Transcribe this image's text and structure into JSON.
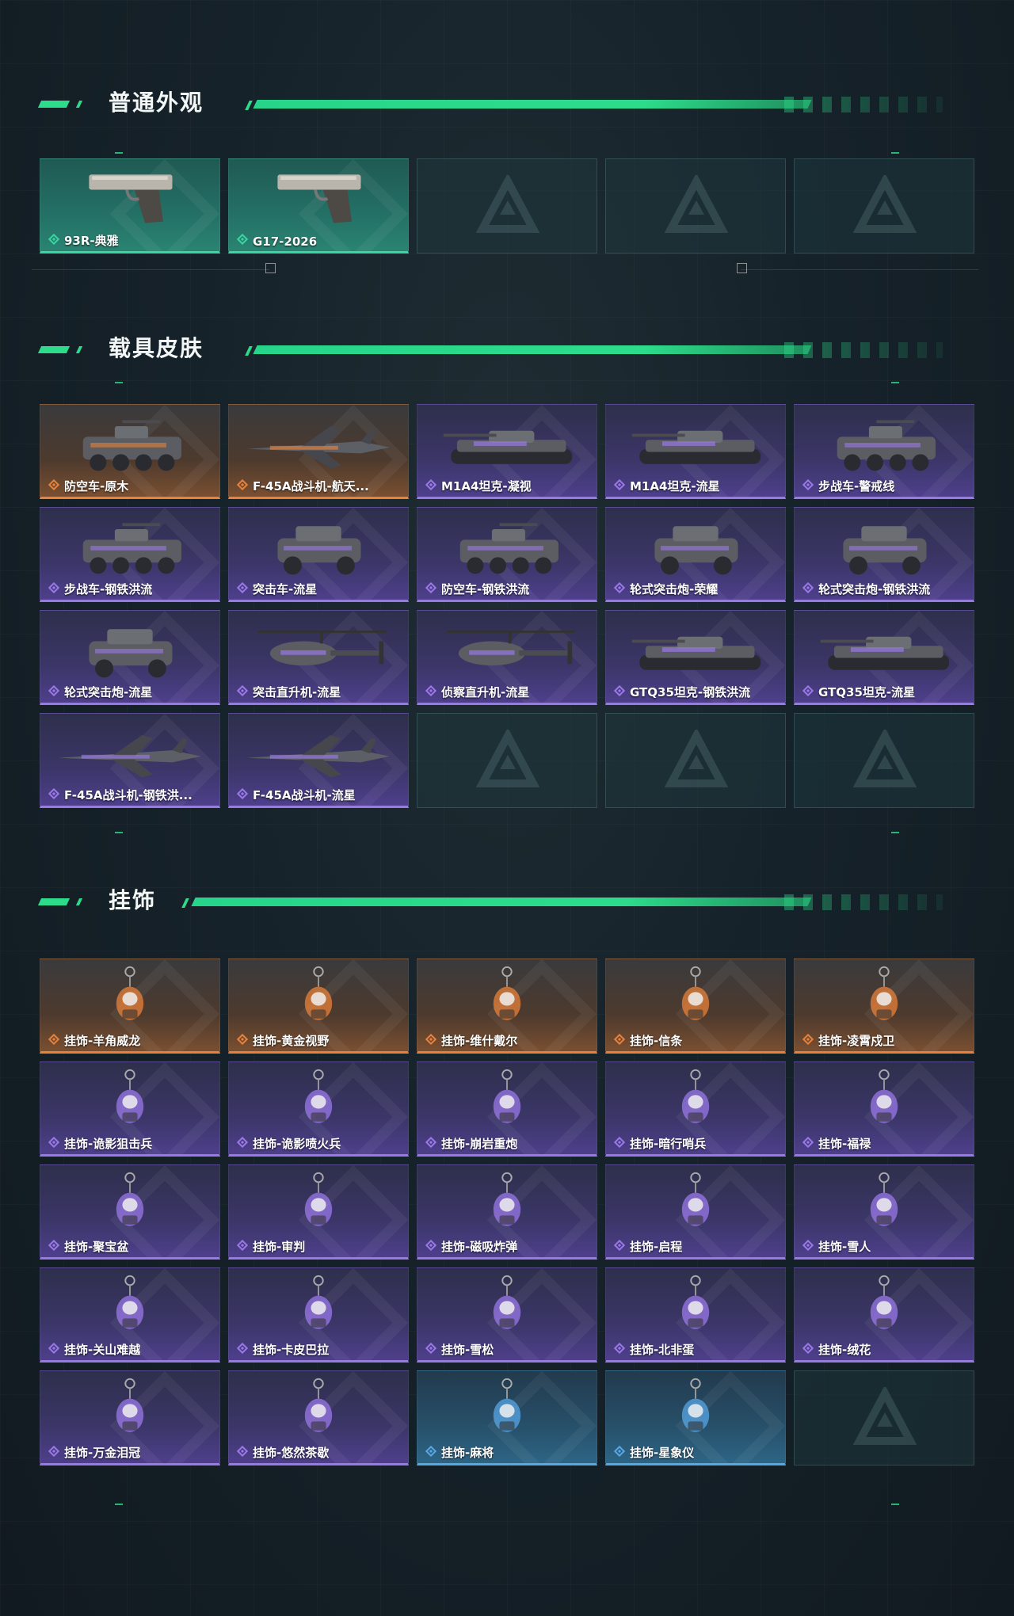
{
  "sections": [
    {
      "title": "普通外观",
      "items": [
        {
          "label": "93R-典雅",
          "rarity": "green",
          "icon": "pistol-icon"
        },
        {
          "label": "G17-2026",
          "rarity": "green",
          "icon": "pistol-icon"
        },
        {
          "label": "",
          "rarity": "empty",
          "icon": "logo-placeholder-icon"
        },
        {
          "label": "",
          "rarity": "empty",
          "icon": "logo-placeholder-icon"
        },
        {
          "label": "",
          "rarity": "empty",
          "icon": "logo-placeholder-icon"
        }
      ]
    },
    {
      "title": "载具皮肤",
      "items": [
        {
          "label": "防空车-原木",
          "rarity": "orange",
          "icon": "armored-vehicle-icon"
        },
        {
          "label": "F-45A战斗机-航天...",
          "rarity": "orange",
          "icon": "jet-icon"
        },
        {
          "label": "M1A4坦克-凝视",
          "rarity": "purple",
          "icon": "tank-icon"
        },
        {
          "label": "M1A4坦克-流星",
          "rarity": "purple",
          "icon": "tank-icon"
        },
        {
          "label": "步战车-警戒线",
          "rarity": "purple",
          "icon": "armored-vehicle-icon"
        },
        {
          "label": "步战车-钢铁洪流",
          "rarity": "purple",
          "icon": "armored-vehicle-icon"
        },
        {
          "label": "突击车-流星",
          "rarity": "purple",
          "icon": "assault-vehicle-icon"
        },
        {
          "label": "防空车-钢铁洪流",
          "rarity": "purple",
          "icon": "armored-vehicle-icon"
        },
        {
          "label": "轮式突击炮-荣耀",
          "rarity": "purple",
          "icon": "assault-vehicle-icon"
        },
        {
          "label": "轮式突击炮-钢铁洪流",
          "rarity": "purple",
          "icon": "assault-vehicle-icon"
        },
        {
          "label": "轮式突击炮-流星",
          "rarity": "purple",
          "icon": "assault-vehicle-icon"
        },
        {
          "label": "突击直升机-流星",
          "rarity": "purple",
          "icon": "helicopter-icon"
        },
        {
          "label": "侦察直升机-流星",
          "rarity": "purple",
          "icon": "helicopter-icon"
        },
        {
          "label": "GTQ35坦克-钢铁洪流",
          "rarity": "purple",
          "icon": "tank-icon"
        },
        {
          "label": "GTQ35坦克-流星",
          "rarity": "purple",
          "icon": "tank-icon"
        },
        {
          "label": "F-45A战斗机-钢铁洪...",
          "rarity": "purple",
          "icon": "jet-icon"
        },
        {
          "label": "F-45A战斗机-流星",
          "rarity": "purple",
          "icon": "jet-icon"
        },
        {
          "label": "",
          "rarity": "empty",
          "icon": "logo-placeholder-icon"
        },
        {
          "label": "",
          "rarity": "empty",
          "icon": "logo-placeholder-icon"
        },
        {
          "label": "",
          "rarity": "empty",
          "icon": "logo-placeholder-icon"
        }
      ]
    },
    {
      "title": "挂饰",
      "items": [
        {
          "label": "挂饰-羊角威龙",
          "rarity": "orange",
          "icon": "charm-icon"
        },
        {
          "label": "挂饰-黄金视野",
          "rarity": "orange",
          "icon": "charm-icon"
        },
        {
          "label": "挂饰-维什戴尔",
          "rarity": "orange",
          "icon": "charm-icon"
        },
        {
          "label": "挂饰-信条",
          "rarity": "orange",
          "icon": "charm-icon"
        },
        {
          "label": "挂饰-凌霄戍卫",
          "rarity": "orange",
          "icon": "charm-icon"
        },
        {
          "label": "挂饰-诡影狙击兵",
          "rarity": "purple",
          "icon": "charm-icon"
        },
        {
          "label": "挂饰-诡影喷火兵",
          "rarity": "purple",
          "icon": "charm-icon"
        },
        {
          "label": "挂饰-崩岩重炮",
          "rarity": "purple",
          "icon": "charm-icon"
        },
        {
          "label": "挂饰-暗行哨兵",
          "rarity": "purple",
          "icon": "charm-icon"
        },
        {
          "label": "挂饰-福禄",
          "rarity": "purple",
          "icon": "charm-icon"
        },
        {
          "label": "挂饰-聚宝盆",
          "rarity": "purple",
          "icon": "charm-icon"
        },
        {
          "label": "挂饰-审判",
          "rarity": "purple",
          "icon": "charm-icon"
        },
        {
          "label": "挂饰-磁吸炸弹",
          "rarity": "purple",
          "icon": "charm-icon"
        },
        {
          "label": "挂饰-启程",
          "rarity": "purple",
          "icon": "charm-icon"
        },
        {
          "label": "挂饰-雪人",
          "rarity": "purple",
          "icon": "charm-icon"
        },
        {
          "label": "挂饰-关山难越",
          "rarity": "purple",
          "icon": "charm-icon"
        },
        {
          "label": "挂饰-卡皮巴拉",
          "rarity": "purple",
          "icon": "charm-icon"
        },
        {
          "label": "挂饰-雪松",
          "rarity": "purple",
          "icon": "charm-icon"
        },
        {
          "label": "挂饰-北非蛋",
          "rarity": "purple",
          "icon": "charm-icon"
        },
        {
          "label": "挂饰-绒花",
          "rarity": "purple",
          "icon": "charm-icon"
        },
        {
          "label": "挂饰-万金泪冠",
          "rarity": "purple",
          "icon": "charm-icon"
        },
        {
          "label": "挂饰-悠然茶歇",
          "rarity": "purple",
          "icon": "charm-icon"
        },
        {
          "label": "挂饰-麻将",
          "rarity": "blue",
          "icon": "charm-icon"
        },
        {
          "label": "挂饰-星象仪",
          "rarity": "blue",
          "icon": "charm-icon"
        },
        {
          "label": "",
          "rarity": "empty",
          "icon": "logo-placeholder-icon"
        }
      ]
    }
  ],
  "colors": {
    "accent": "#2ddc8b",
    "orange": "#e8823a",
    "purple": "#9a78e8",
    "green": "#38d6a0",
    "blue": "#57a6e6"
  }
}
